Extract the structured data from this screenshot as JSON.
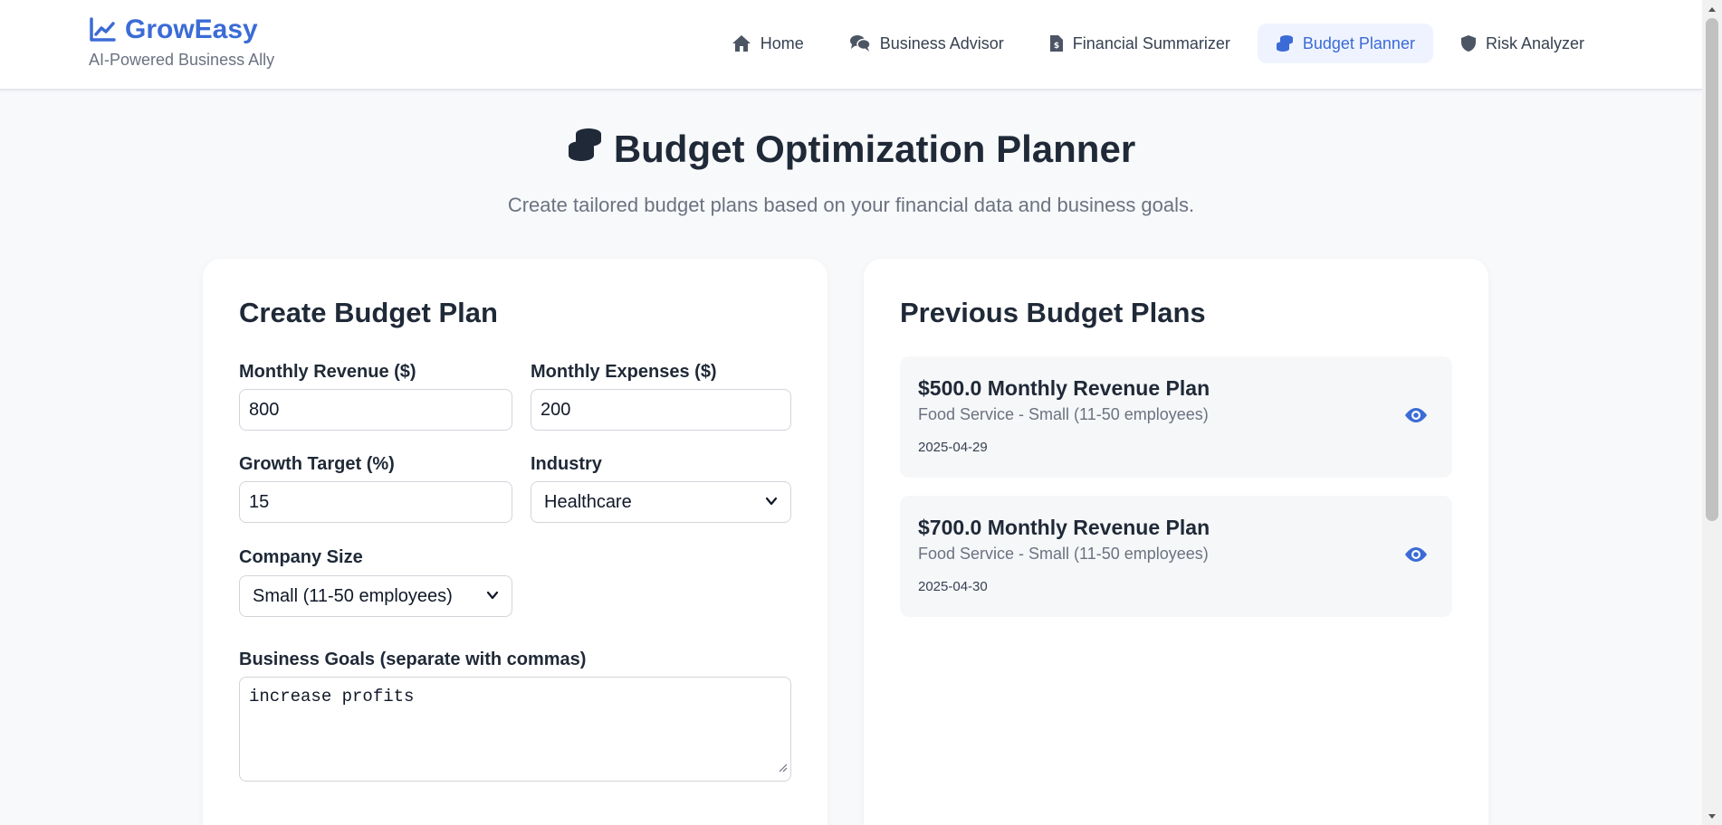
{
  "brand": {
    "name": "GrowEasy",
    "tagline": "AI-Powered Business Ally",
    "accent_color": "#3b6bd6"
  },
  "nav": [
    {
      "label": "Home",
      "icon": "home-icon",
      "active": false
    },
    {
      "label": "Business Advisor",
      "icon": "chat-icon",
      "active": false
    },
    {
      "label": "Financial Summarizer",
      "icon": "invoice-icon",
      "active": false
    },
    {
      "label": "Budget Planner",
      "icon": "coins-icon",
      "active": true
    },
    {
      "label": "Risk Analyzer",
      "icon": "shield-icon",
      "active": false
    }
  ],
  "hero": {
    "title": "Budget Optimization Planner",
    "subtitle": "Create tailored budget plans based on your financial data and business goals."
  },
  "form": {
    "title": "Create Budget Plan",
    "revenue": {
      "label": "Monthly Revenue ($)",
      "value": "800"
    },
    "expenses": {
      "label": "Monthly Expenses ($)",
      "value": "200"
    },
    "growth": {
      "label": "Growth Target (%)",
      "value": "15"
    },
    "industry": {
      "label": "Industry",
      "value": "Healthcare"
    },
    "company_size": {
      "label": "Company Size",
      "value": "Small (11-50 employees)"
    },
    "goals": {
      "label": "Business Goals (separate with commas)",
      "value": "increase profits"
    }
  },
  "plans": {
    "title": "Previous Budget Plans",
    "items": [
      {
        "title": "$500.0 Monthly Revenue Plan",
        "subtitle": "Food Service - Small (11-50 employees)",
        "date": "2025-04-29"
      },
      {
        "title": "$700.0 Monthly Revenue Plan",
        "subtitle": "Food Service - Small (11-50 employees)",
        "date": "2025-04-30"
      }
    ]
  }
}
